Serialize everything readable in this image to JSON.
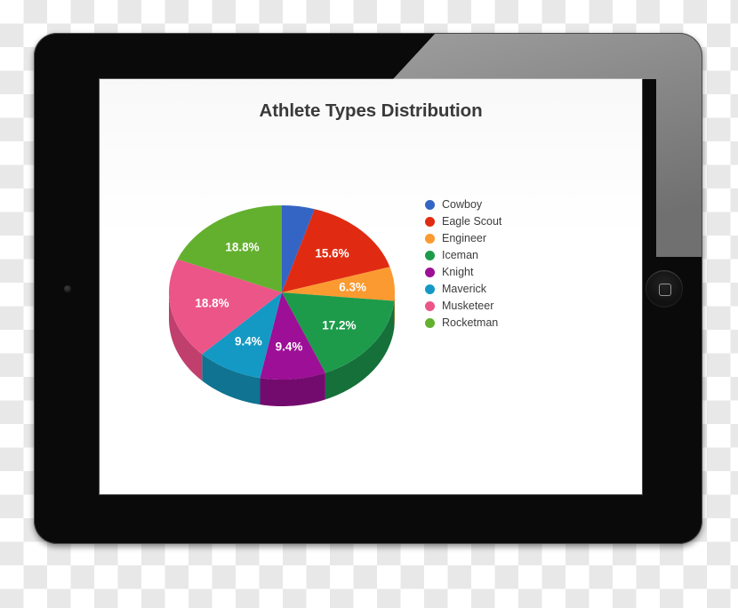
{
  "device": {
    "name": "tablet-device",
    "home_button": "home-button",
    "camera": "front-camera"
  },
  "chart_data": {
    "type": "pie",
    "title": "Athlete Types Distribution",
    "xlabel": "",
    "ylabel": "",
    "legend_position": "right",
    "three_d": true,
    "categories": [
      "Cowboy",
      "Eagle Scout",
      "Engineer",
      "Iceman",
      "Knight",
      "Maverick",
      "Musketeer",
      "Rocketman"
    ],
    "values": [
      4.7,
      15.6,
      6.3,
      17.2,
      9.4,
      9.4,
      18.8,
      18.8
    ],
    "value_labels": [
      "",
      "15.6%",
      "6.3%",
      "17.2%",
      "9.4%",
      "9.4%",
      "18.8%",
      "18.8%"
    ],
    "colors": [
      "#3465c4",
      "#e02b12",
      "#fb9a31",
      "#1d9b4b",
      "#9c0f96",
      "#1499c4",
      "#ec5588",
      "#63b02f"
    ],
    "side_colors": [
      "#244a91",
      "#a61f0c",
      "#c07425",
      "#15703a",
      "#730b6e",
      "#0f7391",
      "#c03f6d",
      "#4a8524"
    ]
  },
  "legend": {
    "items": [
      {
        "label": "Cowboy",
        "color": "#3465c4"
      },
      {
        "label": "Eagle Scout",
        "color": "#e02b12"
      },
      {
        "label": "Engineer",
        "color": "#fb9a31"
      },
      {
        "label": "Iceman",
        "color": "#1d9b4b"
      },
      {
        "label": "Knight",
        "color": "#9c0f96"
      },
      {
        "label": "Maverick",
        "color": "#1499c4"
      },
      {
        "label": "Musketeer",
        "color": "#ec5588"
      },
      {
        "label": "Rocketman",
        "color": "#63b02f"
      }
    ]
  }
}
